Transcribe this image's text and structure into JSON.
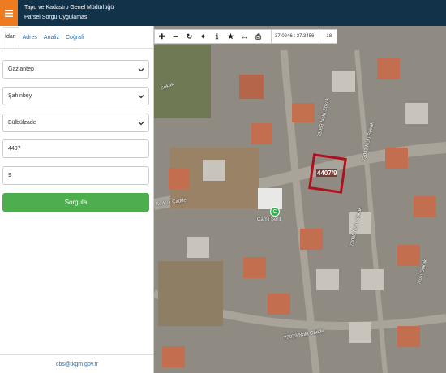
{
  "header": {
    "menu_icon": "hamburger-icon",
    "title": "Tapu ve Kadastro Genel Müdürlüğü",
    "subtitle": "Parsel Sorgu Uygulaması",
    "menu_color": "#f07b1e",
    "bar_color": "#12324a"
  },
  "sidebar": {
    "tabs": [
      {
        "label": "İdari"
      },
      {
        "label": "Adres"
      },
      {
        "label": "Analiz"
      },
      {
        "label": "Coğrafi"
      }
    ],
    "il_select": "Gaziantep",
    "ilce_select": "Şahinbey",
    "mahalle_select": "Bülbülzade",
    "ada_value": "4407",
    "parsel_value": "9",
    "submit_label": "Sorgula",
    "submit_color": "#4cae4c",
    "footer_email": "cbs@tkgm.gov.tr"
  },
  "map": {
    "toolbar": {
      "tools": [
        "plus-icon",
        "minus-icon",
        "refresh-icon",
        "locate-icon",
        "info-icon",
        "star-icon",
        "measure-icon",
        "print-icon"
      ],
      "coordinates": "37.0246 : 37.3456",
      "zoom": "18"
    },
    "parcel_label": "4407/9",
    "parcel_color": "#b0101e",
    "pin_label": "C",
    "street_labels": {
      "s1": "Sokak",
      "s2": "73053 Nolu Sokak",
      "s3": "73037 Nolu Sokak",
      "s4": "Kerkük Cadde",
      "s5": "Camii Şerif",
      "s6": "73035 Nolu Sokak",
      "s7": "73039 Nolu Cadde",
      "s8": "Nolu Sokak"
    }
  }
}
